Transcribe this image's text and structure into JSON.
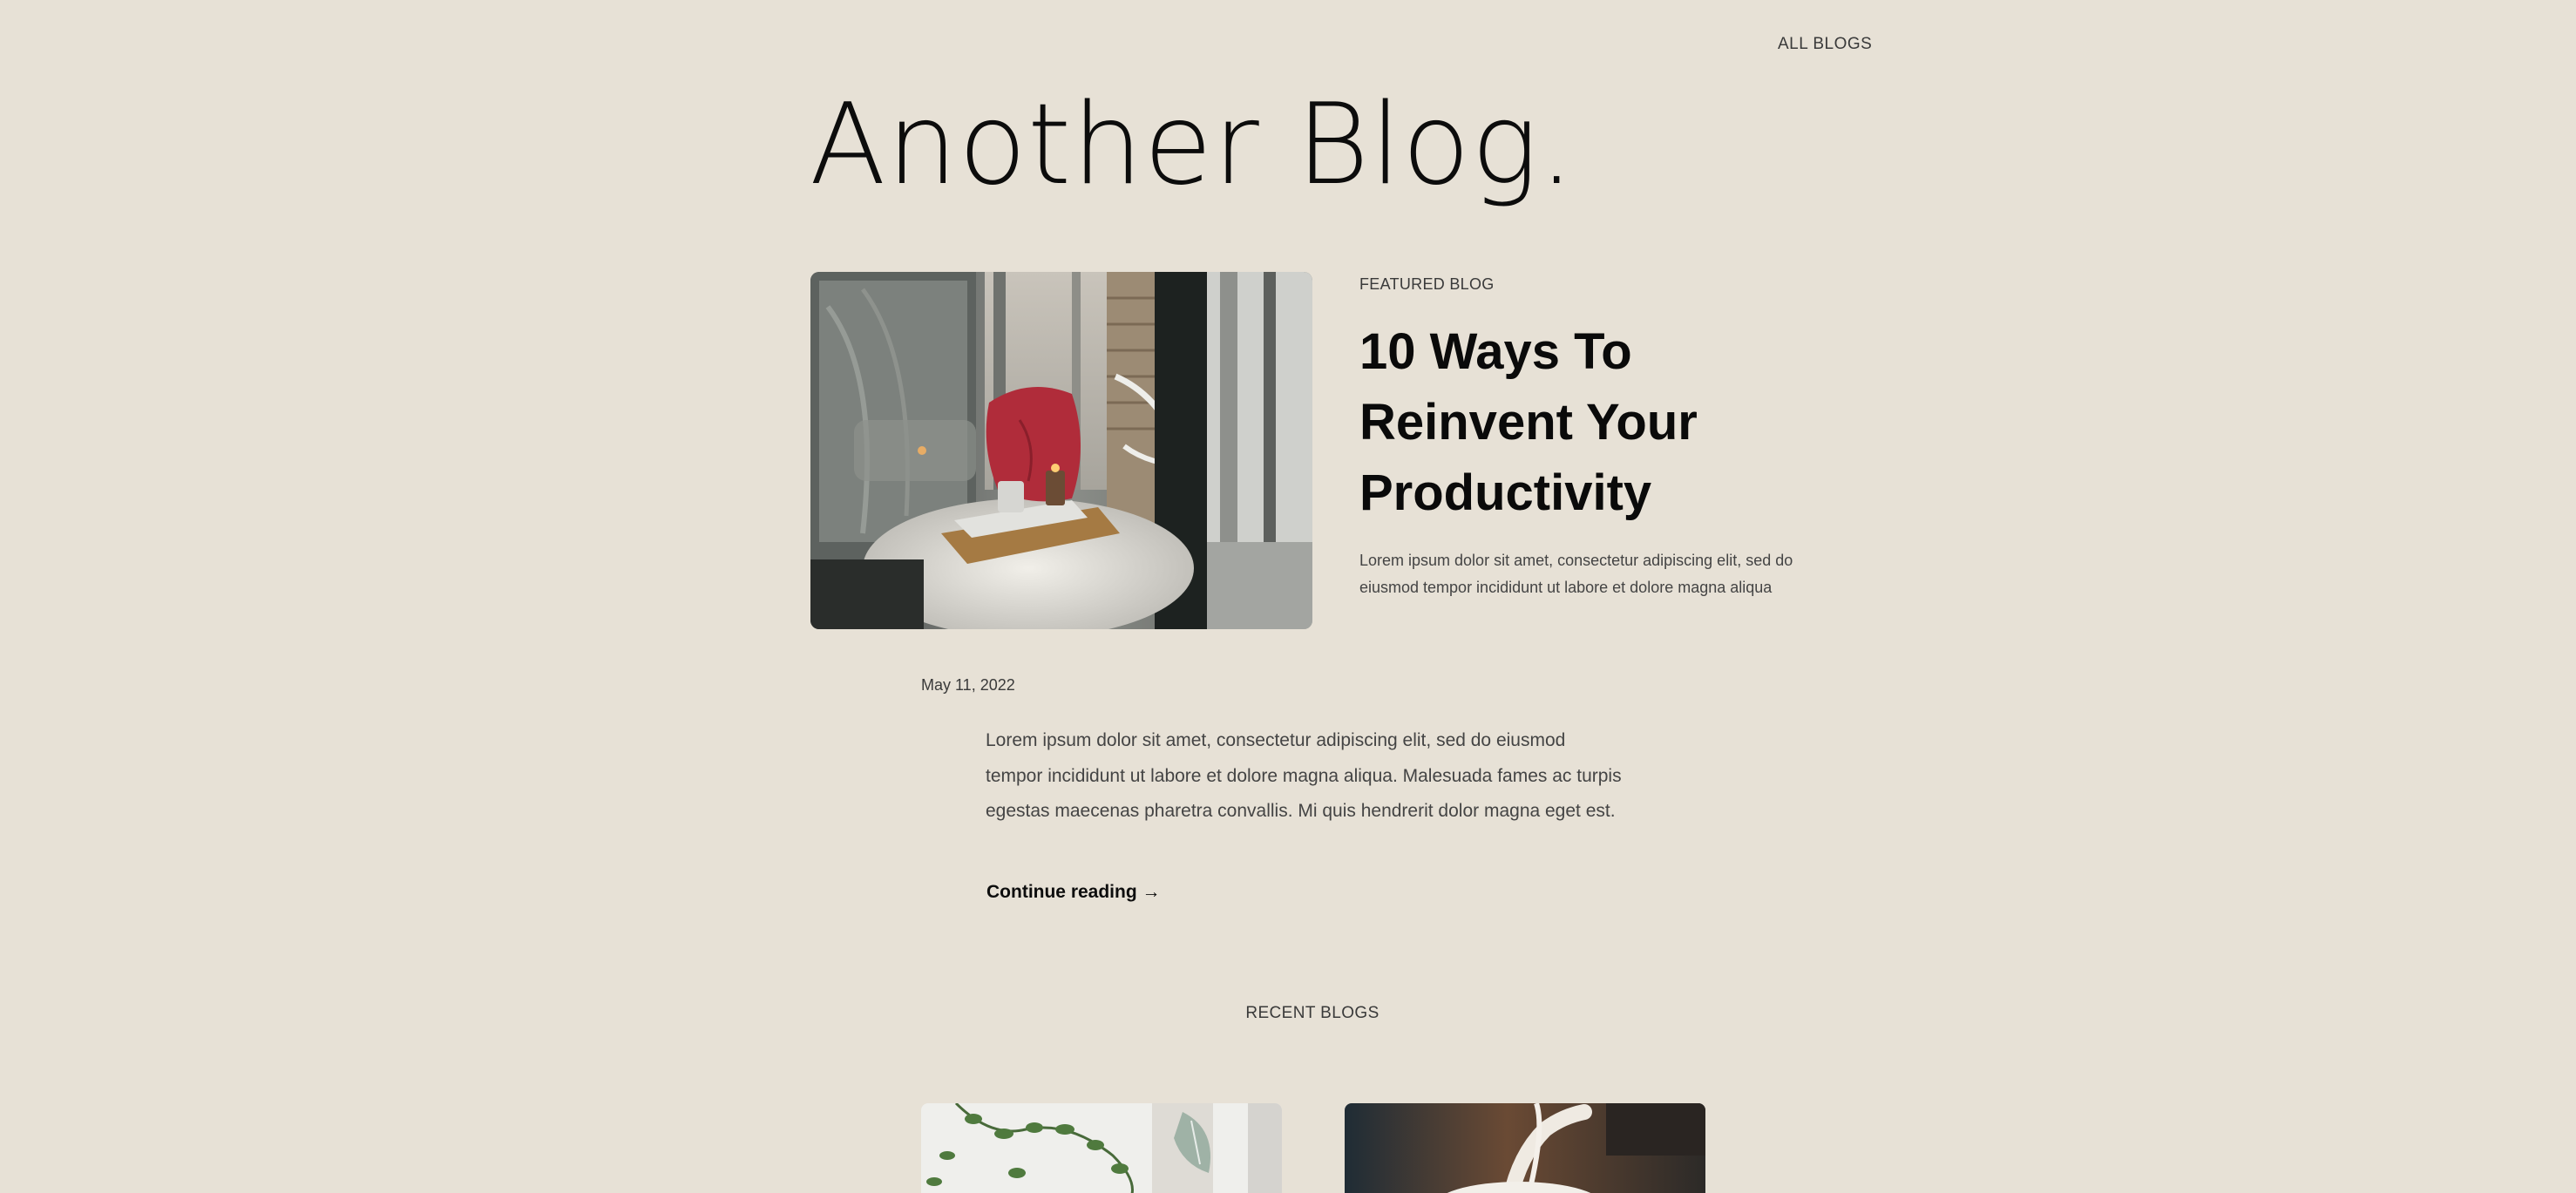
{
  "nav": {
    "all_blogs": "ALL BLOGS"
  },
  "site": {
    "title": "Another Blog."
  },
  "featured": {
    "label": "FEATURED BLOG",
    "title": "10 Ways To Reinvent Your Productivity",
    "excerpt": "Lorem ipsum dolor sit amet, consectetur adipiscing elit, sed do eiusmod tempor incididunt ut labore et dolore magna aliqua"
  },
  "post": {
    "date": "May 11, 2022",
    "excerpt": "Lorem ipsum dolor sit amet, consectetur adipiscing elit, sed do eiusmod tempor incididunt ut labore et dolore magna aliqua. Malesuada fames ac turpis egestas maecenas pharetra convallis. Mi quis hendrerit dolor magna eget est.",
    "continue_label": "Continue reading →"
  },
  "recent": {
    "label": "RECENT BLOGS"
  },
  "colors": {
    "background": "#e7e1d6",
    "text": "#111111",
    "muted": "#3a3a3a"
  }
}
